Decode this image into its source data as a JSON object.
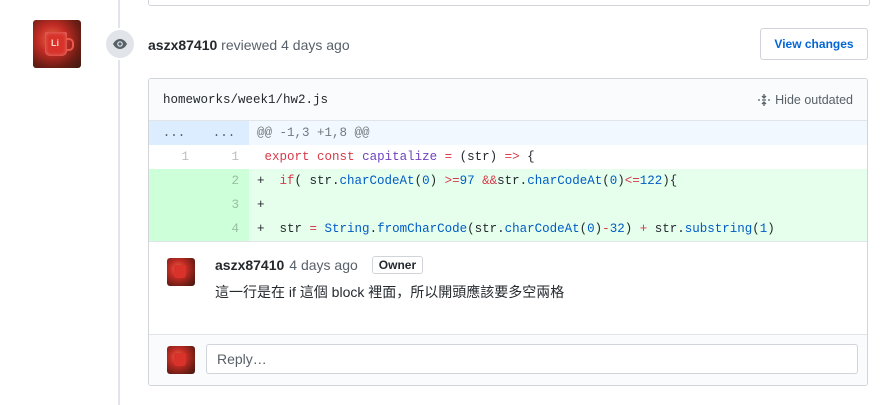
{
  "review": {
    "author": "aszx87410",
    "action_text": " reviewed 4 days ago",
    "view_changes_label": "View changes"
  },
  "file": {
    "path": "homeworks/week1/hw2.js",
    "hide_outdated_label": "Hide outdated"
  },
  "diff": {
    "hunk": {
      "old": "...",
      "new": "...",
      "header": "@@ -1,3 +1,8 @@"
    },
    "lines": [
      {
        "old": "1",
        "new": "1",
        "type": "context"
      },
      {
        "old": "",
        "new": "2",
        "type": "add"
      },
      {
        "old": "",
        "new": "3",
        "type": "add"
      },
      {
        "old": "",
        "new": "4",
        "type": "add"
      }
    ]
  },
  "comment": {
    "author": "aszx87410",
    "time": "4 days ago",
    "badge": "Owner",
    "body": "這一行是在 if 這個 block 裡面，所以開頭應該要多空兩格"
  },
  "reply": {
    "placeholder": "Reply…"
  },
  "colors": {
    "link": "#0366d6",
    "add_bg": "#e6ffed",
    "add_num_bg": "#cdffd8",
    "hunk_bg": "#f1f8ff",
    "keyword": "#d73a49",
    "function": "#6f42c1",
    "constant": "#005cc5"
  },
  "icons": {
    "review": "eye-icon",
    "hide_outdated": "unfold-icon"
  }
}
